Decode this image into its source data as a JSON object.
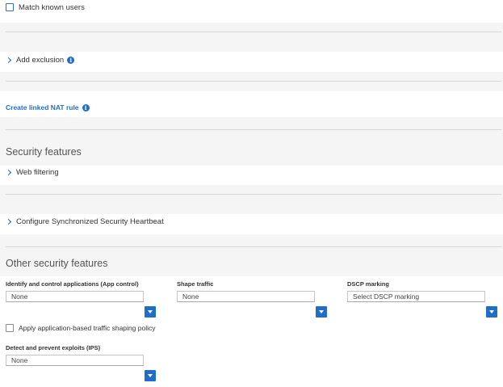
{
  "match_users": {
    "label": "Match known users",
    "checked": false
  },
  "exclusion": {
    "label": "Add exclusion"
  },
  "nat": {
    "label": "Create linked NAT rule"
  },
  "security_features": {
    "heading": "Security features",
    "web_filtering": "Web filtering",
    "heartbeat": "Configure Synchronized Security Heartbeat"
  },
  "other_features": {
    "heading": "Other security features",
    "app_control": {
      "label": "Identify and control applications (App control)",
      "value": "None"
    },
    "shape_traffic": {
      "label": "Shape traffic",
      "value": "None"
    },
    "dscp": {
      "label": "DSCP marking",
      "value": "Select DSCP marking"
    },
    "app_shaping": {
      "label": "Apply application-based traffic shaping policy",
      "checked": false
    },
    "ips": {
      "label": "Detect and prevent exploits (IPS)",
      "value": "None"
    }
  }
}
